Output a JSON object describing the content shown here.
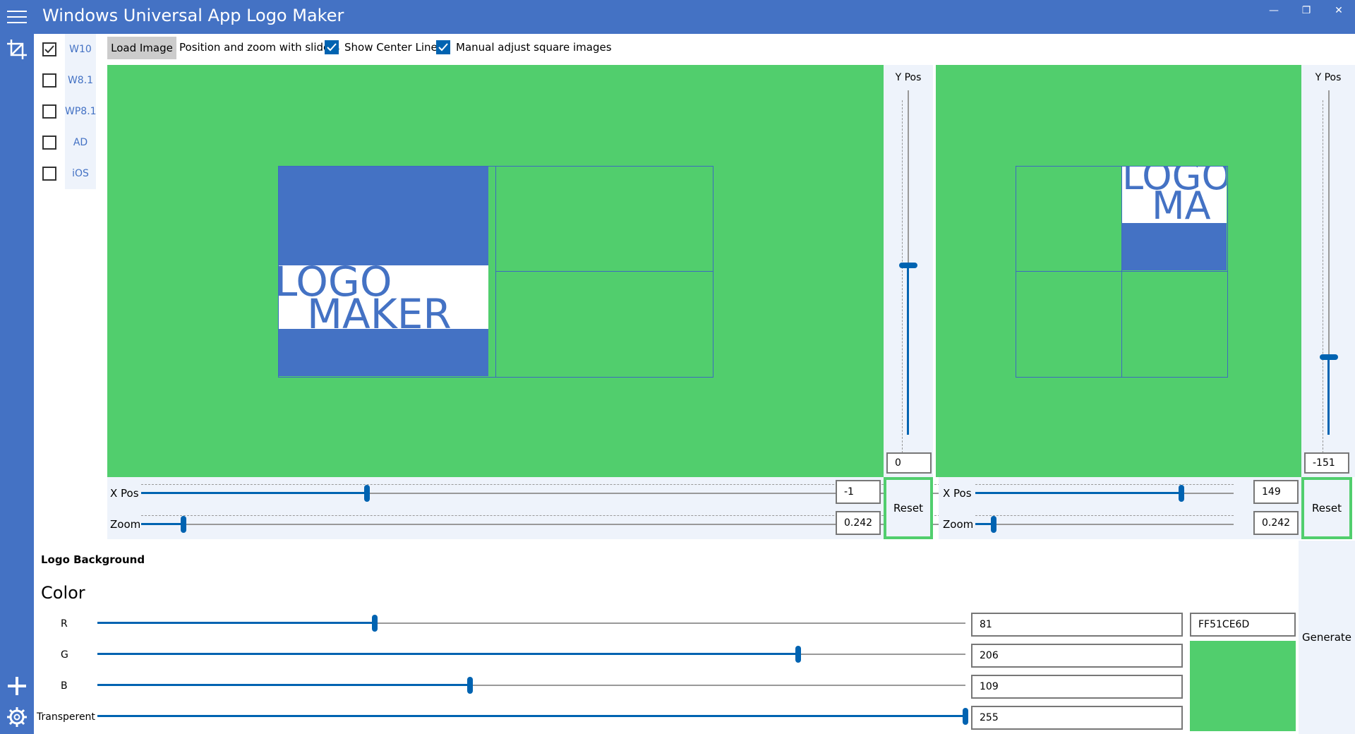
{
  "app": {
    "title": "Windows Universal App Logo Maker"
  },
  "platforms": [
    {
      "label": "W10",
      "checked": true
    },
    {
      "label": "W8.1",
      "checked": false
    },
    {
      "label": "WP8.1",
      "checked": false
    },
    {
      "label": "AD",
      "checked": false
    },
    {
      "label": "iOS",
      "checked": false
    }
  ],
  "toolbar": {
    "load_label": "Load Image",
    "hint_text": "Position and zoom with sliders",
    "center_lines_label": "Show Center Lines",
    "center_lines_checked": true,
    "manual_adjust_label": "Manual adjust square images",
    "manual_adjust_checked": true
  },
  "logo": {
    "line1": "LOGO",
    "line2": "MAKER",
    "line2_short": "MA"
  },
  "left_panel": {
    "ypos_label": "Y Pos",
    "ypos_value": "0",
    "xpos_label": "X Pos",
    "xpos_value": "-1",
    "zoom_label": "Zoom",
    "zoom_value": "0.242",
    "reset_label": "Reset"
  },
  "right_panel": {
    "ypos_label": "Y Pos",
    "ypos_value": "-151",
    "xpos_label": "X Pos",
    "xpos_value": "149",
    "zoom_label": "Zoom",
    "zoom_value": "0.242",
    "reset_label": "Reset"
  },
  "background": {
    "section_title": "Logo Background",
    "color_header": "Color",
    "r_label": "R",
    "r_value": "81",
    "g_label": "G",
    "g_value": "206",
    "b_label": "B",
    "b_value": "109",
    "a_label": "Transperent",
    "a_value": "255",
    "hex_value": "FF51CE6D",
    "swatch_color": "#51ce6d"
  },
  "generate_label": "Generate",
  "colors": {
    "accent": "#4472c4",
    "slider": "#0063b1",
    "preview_bg": "#51ce6d"
  }
}
